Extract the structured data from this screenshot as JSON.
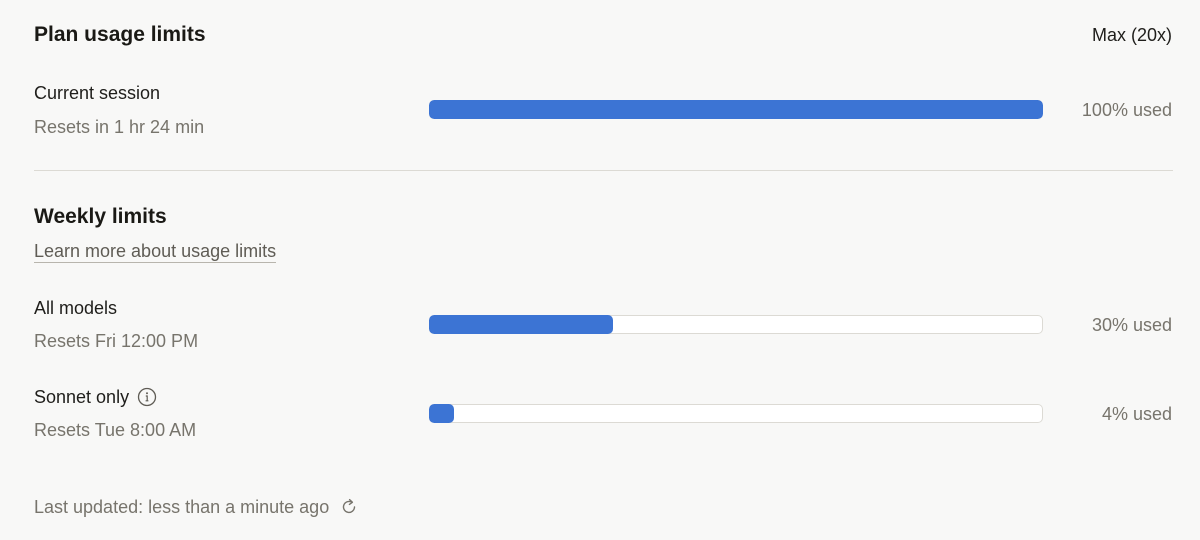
{
  "plan": {
    "title": "Plan usage limits",
    "plan_name": "Max (20x)"
  },
  "current_session": {
    "label": "Current session",
    "resets": "Resets in 1 hr 24 min",
    "used_fraction": 1.0,
    "used_text": "100% used"
  },
  "weekly": {
    "title": "Weekly limits",
    "learn_more": "Learn more about usage limits",
    "all_models": {
      "label": "All models",
      "resets": "Resets Fri 12:00 PM",
      "used_fraction": 0.3,
      "used_text": "30% used"
    },
    "sonnet": {
      "label": "Sonnet only",
      "resets": "Resets Tue 8:00 AM",
      "used_fraction": 0.04,
      "used_text": "4% used"
    }
  },
  "footer": {
    "last_updated": "Last updated: less than a minute ago"
  },
  "icons": {
    "info": "info-icon",
    "refresh": "refresh-icon"
  },
  "colors": {
    "bar_fill": "#3c74d4",
    "bar_track": "#ffffff",
    "background": "#f8f8f7"
  }
}
